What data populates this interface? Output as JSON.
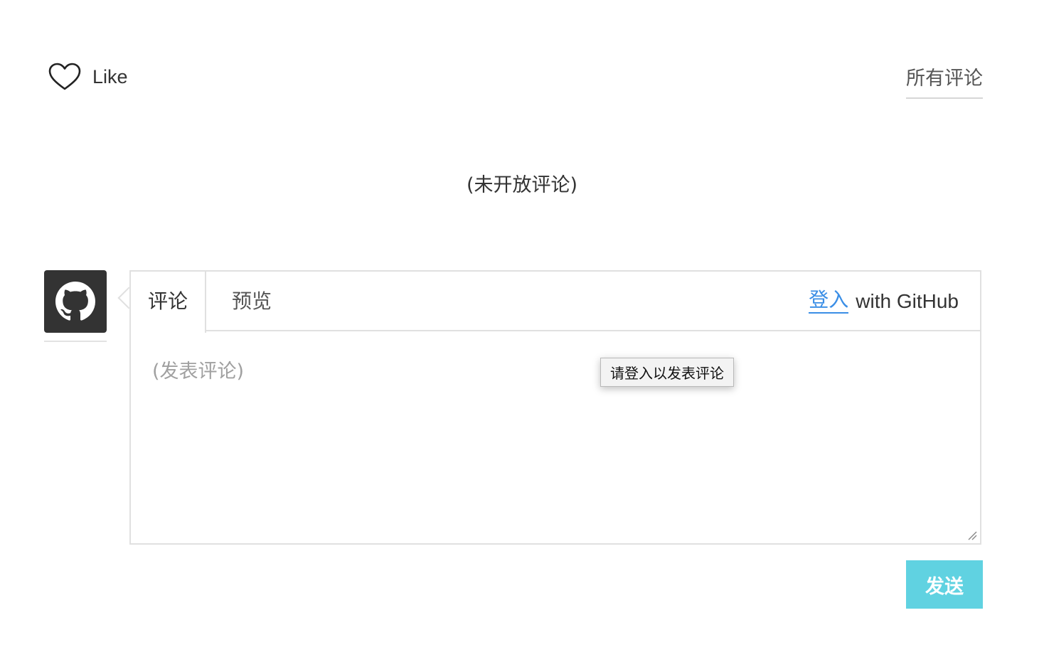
{
  "header": {
    "like_label": "Like",
    "all_comments_label": "所有评论"
  },
  "closed_note": "(未开放评论)",
  "editor": {
    "tabs": [
      {
        "label": "评论",
        "active": true
      },
      {
        "label": "预览",
        "active": false
      }
    ],
    "login_link_label": "登入",
    "login_suffix": "with GitHub",
    "textarea_placeholder": "(发表评论)",
    "tooltip": "请登入以发表评论"
  },
  "submit_label": "发送",
  "icons": {
    "like": "heart-icon",
    "avatar": "github-icon",
    "resize": "resize-handle-icon"
  },
  "colors": {
    "link": "#3a8ee6",
    "submit": "#58d0e0",
    "avatar_bg": "#333333"
  }
}
